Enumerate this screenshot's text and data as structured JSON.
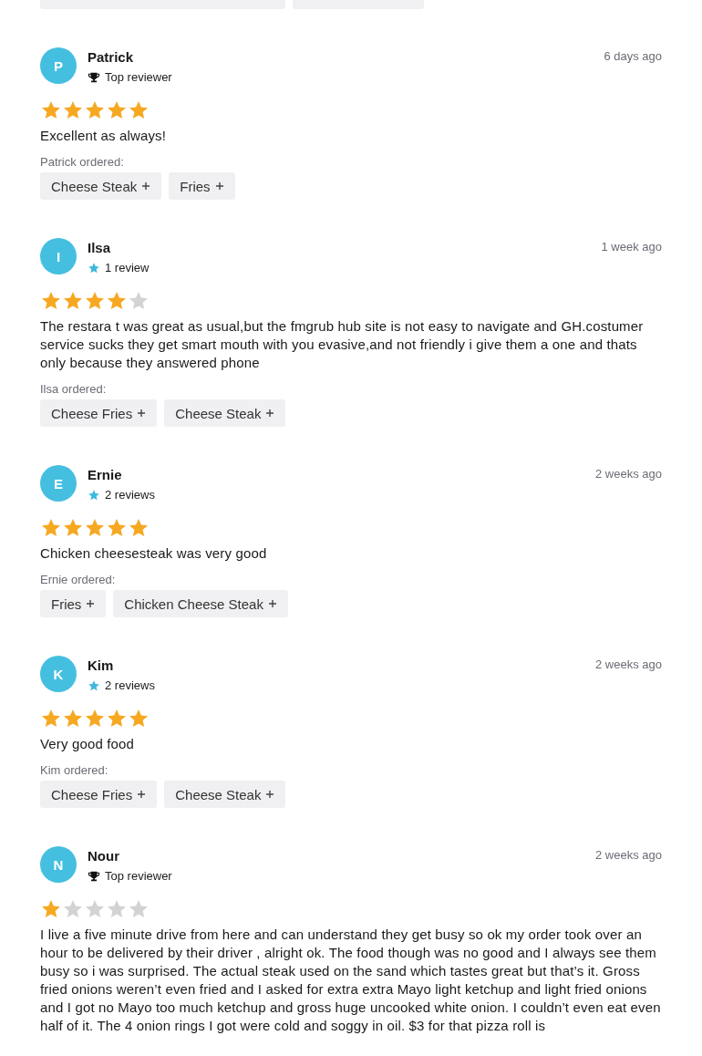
{
  "reviews": [
    {
      "initial": "P",
      "name": "Patrick",
      "badge": {
        "kind": "trophy",
        "text": "Top reviewer"
      },
      "date": "6 days ago",
      "stars": 5,
      "text": "Excellent as always!",
      "ordered_label": "Patrick ordered:",
      "items": [
        "Cheese Steak",
        "Fries"
      ]
    },
    {
      "initial": "I",
      "name": "Ilsa",
      "badge": {
        "kind": "star",
        "text": "1 review"
      },
      "date": "1 week ago",
      "stars": 4,
      "text": "The restara t was great as usual,but the fmgrub hub site is not easy to navigate and GH.costumer service sucks they get smart mouth with you evasive,and not friendly i give them a one and thats only because they answered phone",
      "ordered_label": "Ilsa ordered:",
      "items": [
        "Cheese Fries",
        "Cheese Steak"
      ]
    },
    {
      "initial": "E",
      "name": "Ernie",
      "badge": {
        "kind": "star",
        "text": "2 reviews"
      },
      "date": "2 weeks ago",
      "stars": 5,
      "text": "Chicken cheesesteak was very good",
      "ordered_label": "Ernie ordered:",
      "items": [
        "Fries",
        "Chicken Cheese Steak"
      ]
    },
    {
      "initial": "K",
      "name": "Kim",
      "badge": {
        "kind": "star",
        "text": "2 reviews"
      },
      "date": "2 weeks ago",
      "stars": 5,
      "text": "Very good food",
      "ordered_label": "Kim ordered:",
      "items": [
        "Cheese Fries",
        "Cheese Steak"
      ]
    },
    {
      "initial": "N",
      "name": "Nour",
      "badge": {
        "kind": "trophy",
        "text": "Top reviewer"
      },
      "date": "2 weeks ago",
      "stars": 1,
      "text": "I live a five minute drive from here and can understand they get busy so ok my order took over an hour to be delivered by their driver , alright ok. The food though was no good and I always see them busy so i was surprised. The actual steak used on the sand which tastes great but that’s it. Gross fried onions weren’t even fried and I asked for extra extra Mayo light ketchup and light fried onions and I got no Mayo too much ketchup and gross huge uncooked white onion. I couldn’t even eat even half of it. The 4 onion rings I got were cold and soggy in oil. $3 for that pizza roll is"
    }
  ]
}
